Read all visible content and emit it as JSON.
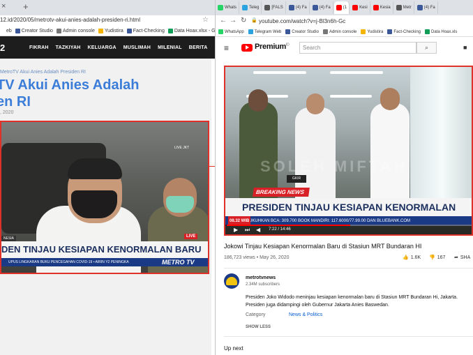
{
  "left": {
    "tab_close": "×",
    "tab_new": "+",
    "url": "12.id/2020/05/metrotv-akui-anies-adalah-presiden-ri.html",
    "bookmarks": [
      {
        "label": "eb",
        "color": "#ffffff"
      },
      {
        "label": "Creator Studio",
        "color": "#3b5998"
      },
      {
        "label": "Admin console",
        "color": "#777777"
      },
      {
        "label": "Yudistira",
        "color": "#f4b400"
      },
      {
        "label": "Fact-Checking",
        "color": "#3b5998"
      },
      {
        "label": "Data Hoax.xlsx - Go...",
        "color": "#0f9d58"
      }
    ],
    "site_logo": "2",
    "menu": [
      "FIKRAH",
      "TAZKIYAH",
      "KELUARGA",
      "MUSLIMAH",
      "MILENIAL",
      "BERITA"
    ],
    "breadcrumb": "MetroTV Akui Anies Adalah Presiden RI",
    "headline_line1": "TV Akui Anies Adalah",
    "headline_line2": "en RI",
    "date": ", 2020",
    "video": {
      "banner": "DEN TINJAU KESIAPAN KENORMALAN BARU",
      "tag": "NESIA",
      "live": "LIVE",
      "ticker": "UPUS LINGKARAN BUKU PENCEGAHAN COVID-19 • AIRIN Y2 PENINGKA",
      "logo": "METRO TV",
      "corner": "LIVE  JKT"
    }
  },
  "right": {
    "tabs": [
      {
        "label": "Whats",
        "color": "#25d366",
        "active": false
      },
      {
        "label": "Teleg",
        "color": "#2aa3df",
        "active": false
      },
      {
        "label": "[FALS",
        "color": "#555555",
        "active": false
      },
      {
        "label": "(4) Fa",
        "color": "#3b5998",
        "active": false
      },
      {
        "label": "(4) Fa",
        "color": "#3b5998",
        "active": false
      },
      {
        "label": "(1",
        "color": "#ff0000",
        "active": true
      },
      {
        "label": "Kesi",
        "color": "#ff0000",
        "active": false
      },
      {
        "label": "Kesia",
        "color": "#ff0000",
        "active": false
      },
      {
        "label": "Metr",
        "color": "#555555",
        "active": false
      },
      {
        "label": "(4) Fa",
        "color": "#3b5998",
        "active": false
      }
    ],
    "url": "youtube.com/watch?v=j-Bl3n6h-Gc",
    "bookmarks": [
      {
        "label": "WhatsApp",
        "color": "#25d366"
      },
      {
        "label": "Telegram Web",
        "color": "#2aa3df"
      },
      {
        "label": "Creator Studio",
        "color": "#3b5998"
      },
      {
        "label": "Admin console",
        "color": "#777777"
      },
      {
        "label": "Yudistira",
        "color": "#f4b400"
      },
      {
        "label": "Fact-Checking",
        "color": "#3b5998"
      },
      {
        "label": "Data Hoax.xls",
        "color": "#0f9d58"
      }
    ],
    "yt": {
      "logo_text": "Premium",
      "logo_sup": "ID",
      "search_placeholder": "Search"
    },
    "video": {
      "breaking": "BREAKING NEWS",
      "sign": "GKIR",
      "banner": "PRESIDEN TINJAU KESIAPAN KENORMALAN",
      "time_tag": "08.32 WIB",
      "ticker": "DIKUKUHKAN BCA: 309.700 BOOK MANDIRI: 117.6000/77.99.00 DAN BLUEBANK.COM",
      "time": "7:22 / 14:46",
      "progress": 0.5,
      "watermark": "SOLEH MIFTAH"
    },
    "title": "Jokowi Tinjau Kesiapan Kenormalan Baru di Stasiun MRT Bundaran HI",
    "stats": "186,723 views • May 26, 2020",
    "likes": "1.6K",
    "dislikes": "167",
    "share": "SHA",
    "channel": {
      "name": "metrotvnews",
      "subs": "2.34M subscribers"
    },
    "desc1": "Presiden Joko Widodo meninjau kesiapan kenormalan baru di Stasiun MRT Bundaran Hi, Jakarta.",
    "desc2": "Presiden juga didampingi oleh Gubernur Jakarta Anies Baswedan.",
    "category_label": "Category",
    "category_value": "News & Politics",
    "show_less": "SHOW LESS",
    "up_next": "Up next"
  }
}
